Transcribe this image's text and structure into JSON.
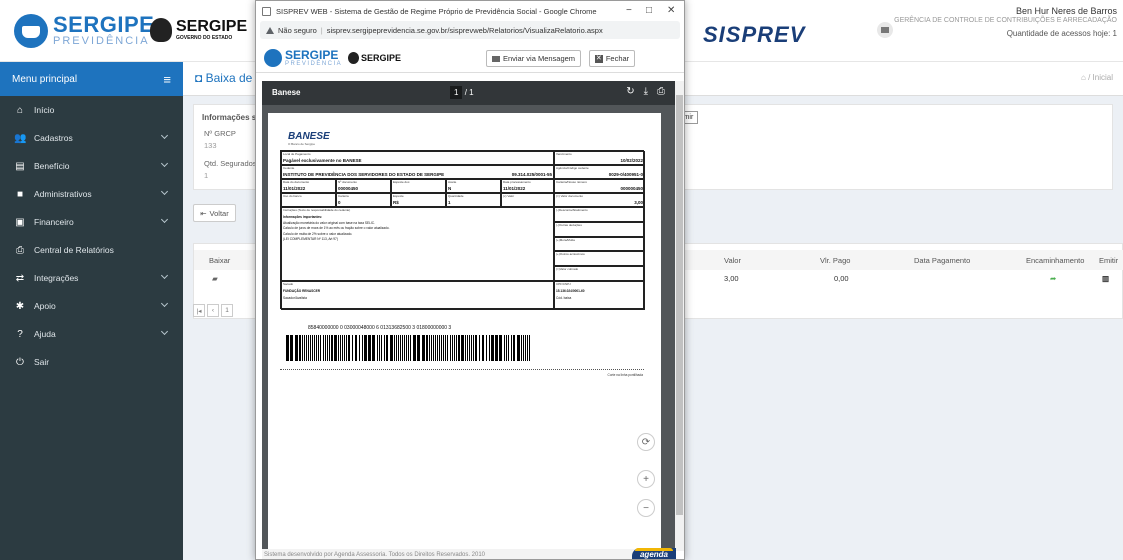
{
  "app": {
    "logo_text": "SERGIPE",
    "logo_sub": "PREVIDÊNCIA",
    "gov_title": "SERGIPE",
    "gov_sub": "GOVERNO DO ESTADO",
    "brand": "SISPREV"
  },
  "user": {
    "name": "Ben Hur Neres de Barros",
    "dept": "GERÊNCIA DE CONTROLE DE CONTRIBUIÇÕES E ARRECADAÇÃO",
    "access": "Quantidade de acessos hoje: 1"
  },
  "sidebar": {
    "title": "Menu principal",
    "items": [
      {
        "label": "Início",
        "icon": "home-icon",
        "glyph": "⌂",
        "chevron": false
      },
      {
        "label": "Cadastros",
        "icon": "users-icon",
        "glyph": "👥",
        "chevron": true
      },
      {
        "label": "Benefício",
        "icon": "document-icon",
        "glyph": "▤",
        "chevron": true
      },
      {
        "label": "Administrativos",
        "icon": "folder-icon",
        "glyph": "■",
        "chevron": true
      },
      {
        "label": "Financeiro",
        "icon": "money-icon",
        "glyph": "▣",
        "chevron": true
      },
      {
        "label": "Central de Relatórios",
        "icon": "printer-icon",
        "glyph": "⎙",
        "chevron": false
      },
      {
        "label": "Integrações",
        "icon": "exchange-icon",
        "glyph": "⇄",
        "chevron": true
      },
      {
        "label": "Apoio",
        "icon": "cog-icon",
        "glyph": "✱",
        "chevron": true
      },
      {
        "label": "Ajuda",
        "icon": "question-icon",
        "glyph": "?",
        "chevron": true
      },
      {
        "label": "Sair",
        "icon": "power-icon",
        "glyph": "⏻",
        "chevron": false
      }
    ]
  },
  "page": {
    "title": "Baixa de",
    "breadcrumb": "/ Inicial",
    "info_title": "Informações sobr",
    "grcp_label": "Nº GRCP",
    "grcp_value": "133",
    "qtd_label": "Qtd. Segurados",
    "qtd_value": "1",
    "voltar": "Voltar"
  },
  "table": {
    "headers": {
      "baixar": "Baixar",
      "valor": "Valor",
      "vlr_pago": "Vlr. Pago",
      "data_pagamento": "Data Pagamento",
      "encaminhamento": "Encaminhamento",
      "emitir": "Emitir"
    },
    "row": {
      "valor": "3,00",
      "vlr_pago": "0,00"
    },
    "pager": [
      "|◂",
      "‹",
      "1"
    ]
  },
  "popup": {
    "window_title": "SISPREV WEB - Sistema de Gestão de Regime Próprio de Previdência Social - Google Chrome",
    "security": "Não seguro",
    "url": "sisprev.sergipeprevidencia.se.gov.br/sisprevweb/Relatorios/VisualizaRelatorio.aspx",
    "btn_enviar": "Enviar via Mensagem",
    "btn_fechar": "Fechar",
    "footer": "Sistema desenvolvido por Agenda Assessoria. Todos os Direitos Reservados. 2010",
    "agenda": "agenda"
  },
  "pdf": {
    "name": "Banese",
    "page": "1",
    "pages": "/ 1",
    "tooltip": "Imprimir"
  },
  "boleto": {
    "bank": "BANESE",
    "bank_sub": "O Banco de Sergipe",
    "local_label": "Local de Pagamento",
    "local_value": "Pagável exclusivamente no BANESE",
    "venc_label": "Vencimento",
    "venc_value": "10/02/2022",
    "cedente_label": "Cedente",
    "cedente_value": "INSTITUTO DE PREVIDÊNCIA DOS SERVIDORES DO ESTADO DE SERGIPE",
    "cnpj_value": "09.314.025/0001-55",
    "agencia_label": "Agência/Código cedente",
    "agencia_value": "0029-0/400951-0",
    "data_doc_label": "Data do documento",
    "data_doc_value": "11/01/2022",
    "num_doc_label": "Nº documento",
    "num_doc_value": "00000450",
    "especie_doc_label": "Espécie doc.",
    "aceite_label": "Aceite",
    "aceite_value": "N",
    "data_proc_label": "Data processamento",
    "data_proc_value": "11/01/2022",
    "nosso_label": "Carteira/Nosso número",
    "nosso_value": "000000450",
    "uso_label": "Uso do banco",
    "carteira_label": "Carteira",
    "carteira_value": "0",
    "especie_label": "Espécie",
    "especie_value": "R$",
    "qtd_label": "Quantidade",
    "qtd_value": "1",
    "xvalor_label": "(x) Valor",
    "valor_doc_label": "(=) Valor documento",
    "valor_doc_value": "3,00",
    "instr_title": "Instruções (Texto de responsabilidade do cedente)",
    "instr_lines": [
      "Informações importantes:",
      "Atualização monetária do valor original com base na taxa SELIC.",
      "Calculo de juros de mora de 1% ao mês ou fração sobre o valor atualizado.",
      "Calculo de multa de 2% sobre o valor atualizado.",
      "(LEI COMPLEMENTAR Nº 113, Art 97)"
    ],
    "right_labels": [
      "(-)Desconto/Abatimento",
      "(-)Outras deduções",
      "(+)Mora/Multa",
      "(+)Outros acréscimos",
      "(=)Valor cobrado"
    ],
    "sacado_label": "Sacado",
    "sacado_value": "FUNDAÇÃO RENASCER",
    "sacador_label": "Sacador/Avalista",
    "cpf_label": "CPF/CNPJ",
    "cpf_value": "15.136.024/0001-60",
    "cod_baixa_label": "Cód. baixa",
    "barcode_number": "85840000000 0 03000048000 6 01313682500 3 01800000000 3",
    "corte": "Corte na linha pontilhada"
  }
}
